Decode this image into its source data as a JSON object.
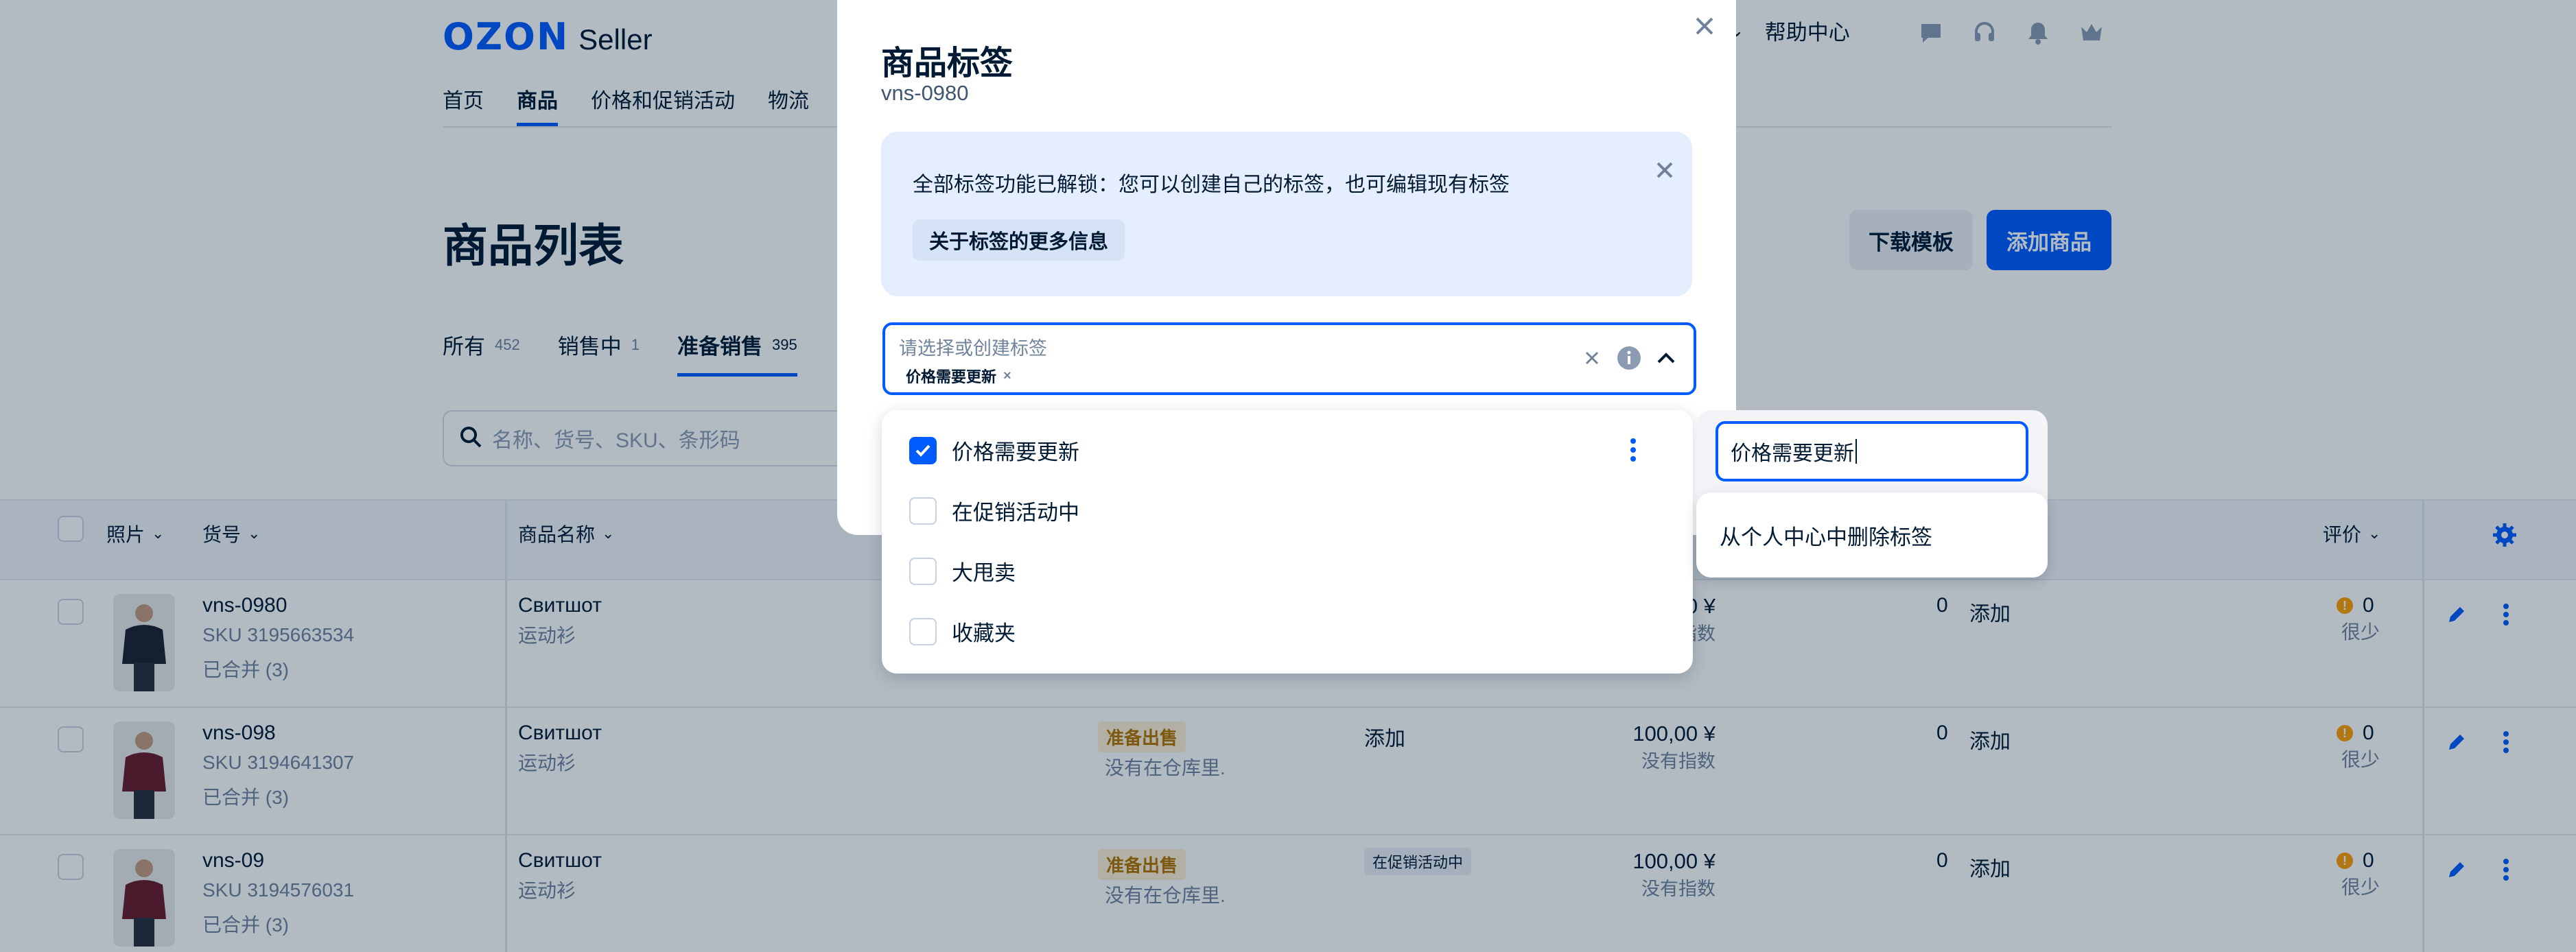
{
  "header": {
    "logo_brand": "OZON",
    "logo_product": "Seller",
    "help": "帮助中心",
    "icons": [
      "chat-icon",
      "headset-icon",
      "bell-icon",
      "crown-icon"
    ]
  },
  "nav": [
    {
      "label": "首页"
    },
    {
      "label": "商品"
    },
    {
      "label": "价格和促销活动"
    },
    {
      "label": "物流"
    }
  ],
  "page": {
    "title": "商品列表",
    "download_template": "下载模板",
    "add_product": "添加商品"
  },
  "status_tabs": [
    {
      "label": "所有",
      "count": "452"
    },
    {
      "label": "销售中",
      "count": "1"
    },
    {
      "label": "准备销售",
      "count": "395"
    }
  ],
  "search": {
    "placeholder": "名称、货号、SKU、条形码"
  },
  "table": {
    "headers": {
      "photo": "照片",
      "sku": "货号",
      "name": "商品名称",
      "rating": "评价"
    },
    "rows": [
      {
        "article": "vns-0980",
        "sku": "SKU 3195663534",
        "merged": "已合并 (3)",
        "name": "Свитшот",
        "name_sub": "运动衫",
        "status": "",
        "status_sub": "",
        "tag": "",
        "price": "00 ¥",
        "price_sub": "指数",
        "stock": "0",
        "add": "添加",
        "rating": "0",
        "rating_sub": "很少"
      },
      {
        "article": "vns-098",
        "sku": "SKU 3194641307",
        "merged": "已合并 (3)",
        "name": "Свитшот",
        "name_sub": "运动衫",
        "status": "准备出售",
        "status_sub": "没有在仓库里.",
        "tag": "添加",
        "price": "100,00 ¥",
        "price_sub": "没有指数",
        "stock": "0",
        "add": "添加",
        "rating": "0",
        "rating_sub": "很少"
      },
      {
        "article": "vns-09",
        "sku": "SKU 3194576031",
        "merged": "已合并 (3)",
        "name": "Свитшот",
        "name_sub": "运动衫",
        "status": "准备出售",
        "status_sub": "没有在仓库里.",
        "tag": "在促销活动中",
        "price": "100,00 ¥",
        "price_sub": "没有指数",
        "stock": "0",
        "add": "添加",
        "rating": "0",
        "rating_sub": "很少"
      }
    ]
  },
  "modal": {
    "title": "商品标签",
    "subtitle": "vns-0980",
    "info_text": "全部标签功能已解锁：您可以创建自己的标签，也可编辑现有标签",
    "info_button": "关于标签的更多信息",
    "select_placeholder": "请选择或创建标签",
    "selected_chip": "价格需要更新",
    "options": [
      {
        "label": "价格需要更新",
        "checked": true
      },
      {
        "label": "在促销活动中",
        "checked": false
      },
      {
        "label": "大甩卖",
        "checked": false
      },
      {
        "label": "收藏夹",
        "checked": false
      }
    ],
    "edit_value": "价格需要更新",
    "edit_menu_item": "从个人中心中删除标签"
  },
  "colors": {
    "accent": "#005bff",
    "warn": "#ff9f00",
    "text": "#001a34"
  }
}
